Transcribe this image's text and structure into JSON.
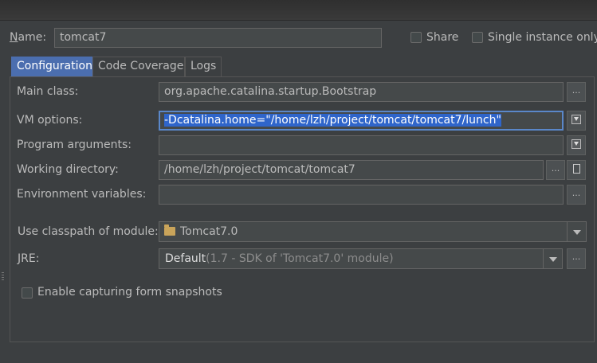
{
  "header": {
    "name_label": "Name:",
    "name_value": "tomcat7",
    "share_label": "Share",
    "single_instance_label": "Single instance only"
  },
  "tabs": [
    {
      "label": "Configuration",
      "active": true
    },
    {
      "label": "Code Coverage",
      "active": false
    },
    {
      "label": "Logs",
      "active": false
    }
  ],
  "form": {
    "main_class": {
      "label": "Main class:",
      "value": "org.apache.catalina.startup.Bootstrap"
    },
    "vm_options": {
      "label": "VM options:",
      "value": "-Dcatalina.home=\"/home/lzh/project/tomcat/tomcat7/lunch\""
    },
    "program_arguments": {
      "label": "Program arguments:",
      "value": ""
    },
    "working_directory": {
      "label": "Working directory:",
      "value": "/home/lzh/project/tomcat/tomcat7"
    },
    "environment_variables": {
      "label": "Environment variables:",
      "value": ""
    },
    "classpath_module": {
      "label": "Use classpath of module:",
      "value": "Tomcat7.0"
    },
    "jre": {
      "label": "JRE:",
      "value": "Default",
      "detail": "(1.7 - SDK of 'Tomcat7.0' module)"
    },
    "capture_snapshots": {
      "label": "Enable capturing form snapshots",
      "checked": false
    }
  },
  "buttons": {
    "ellipsis": "...",
    "expand_icon": "expand-icon"
  },
  "colors": {
    "background": "#3c3f41",
    "active_tab": "#4b6eaf",
    "selection": "#2f65ca",
    "field": "#45494a"
  }
}
